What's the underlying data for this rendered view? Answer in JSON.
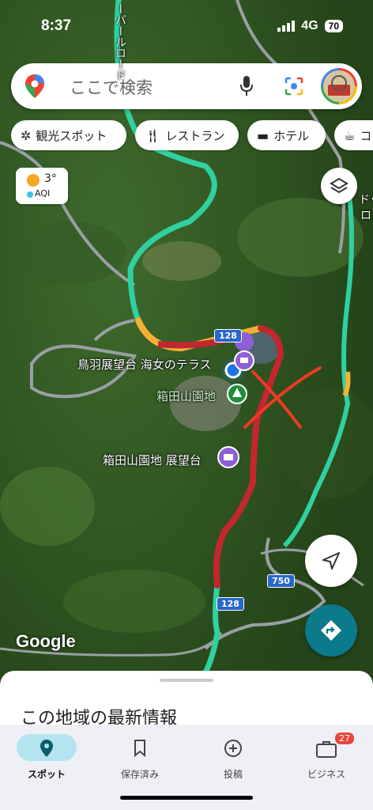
{
  "status_bar": {
    "time": "8:37",
    "network": "4G",
    "battery": "70"
  },
  "search": {
    "placeholder": "ここで検索"
  },
  "chips": [
    {
      "label": "観光スポット",
      "icon": "ferris-wheel-icon"
    },
    {
      "label": "レストラン",
      "icon": "fork-knife-icon"
    },
    {
      "label": "ホテル",
      "icon": "bed-icon"
    },
    {
      "label": "コ",
      "icon": "coffee-icon"
    }
  ],
  "weather": {
    "temp": "3°",
    "aqi": "AQI"
  },
  "map": {
    "places": [
      {
        "label": "鳥羽展望台 海女のテラス"
      },
      {
        "label": "箱田山園地"
      },
      {
        "label": "箱田山園地 展望台"
      }
    ],
    "road_numbers": [
      "128",
      "750",
      "128"
    ],
    "map_text": [
      "ーバールロード",
      "ドッ",
      "ロ"
    ],
    "watermark": "Google"
  },
  "sheet": {
    "title": "この地域の最新情報"
  },
  "bottom_nav": [
    {
      "label": "スポット",
      "icon": "location-pin-icon",
      "active": true
    },
    {
      "label": "保存済み",
      "icon": "bookmark-icon",
      "active": false
    },
    {
      "label": "投稿",
      "icon": "add-circle-icon",
      "active": false
    },
    {
      "label": "ビジネス",
      "icon": "briefcase-icon",
      "active": false,
      "badge": "27"
    }
  ],
  "colors": {
    "route_green": "#2fd1a0",
    "traffic_red": "#c1272d",
    "traffic_yellow": "#f2b134",
    "fab_teal": "#0b7a8a",
    "user_blue": "#1a73e8",
    "pin_purple": "#8e5fd6"
  }
}
